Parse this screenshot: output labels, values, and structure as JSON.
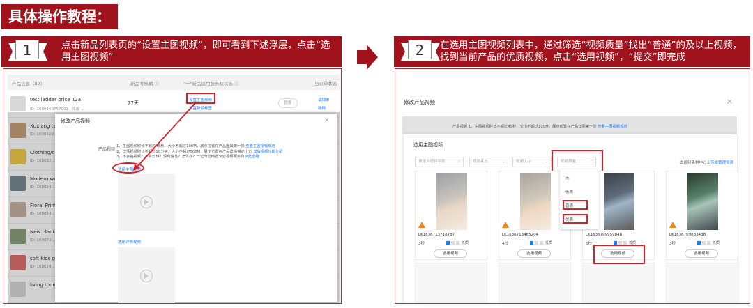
{
  "page_title": "具体操作教程：",
  "step1": {
    "num": "1",
    "text": "点击新品列表页的“设置主图视频”，即可看到下述浮层，点击“选用主图视频”"
  },
  "step2": {
    "num": "2",
    "text": "在选用主图视频列表中，通过筛选“视频质量”找出“普通”的及以上视频，找到当前产品的优质视频，点击“选用视频”，“提交”即完成"
  },
  "left_shot": {
    "header": {
      "col1": "产品信息（82）",
      "col2": "新品考核期 ⓘ",
      "col3": "\"一\"新品适用服务及状态 ⓘ",
      "col4": "当订单状态"
    },
    "rows": [
      {
        "name": "test ladder price 12a",
        "id": "ID: 1600169757001  | 降级 ⌄",
        "extra": "77天",
        "link1": "设置主图视频",
        "link2": "设置新品标签",
        "btn": "提报",
        "right1": "试销单",
        "right2": "新用"
      },
      {
        "name": "Xuxiang test",
        "id": "ID: 1600169..."
      },
      {
        "name": "Clothing/cur",
        "id": "ID: 160032..."
      },
      {
        "name": "Modern woo",
        "id": "ID: 160024..."
      },
      {
        "name": "Floral Print S",
        "id": "ID: 160024..."
      },
      {
        "name": "New planter",
        "id": "ID: 160024..."
      },
      {
        "name": "soft kids girl",
        "id": "ID: 160024..."
      },
      {
        "name": "living room s",
        "id": ""
      }
    ],
    "modal": {
      "title": "修改产品视频",
      "close": "×",
      "label": "产品视频",
      "info1": "1、主图视频时长不超过45秒，大小不超过100M，展示位置在产品图最第一张",
      "info1_link": "查看主图视频规范",
      "info2": "2、详情视频时长不超过10分钟，大小不超过500M，展示位置在产品详情描述上方",
      "info2_link": "详情视频功能介绍",
      "info3": "3、不会拍视频？不会剪辑？没有信息？怎么办？一记为您精选专业视频服务商",
      "info3_link": "点此查看",
      "select_main": "选用主图视频",
      "select_detail": "选用详情视频"
    }
  },
  "right_shot": {
    "title": "修改产品视频",
    "close": "×",
    "bar_label": "产品视频",
    "bar_text": "1、主图视频时长不超过45秒，大小不超过100M，展示位置在产品详图第一张",
    "bar_link": "查看主图视频规范",
    "inner_title": "选用主图视频",
    "search_placeholder": "请输入视频名称",
    "filter_status": "视频状态",
    "filter_size": "视频大小",
    "filter_quality": "视频质量",
    "right_link_prefix": "去视频素材中心上",
    "right_link": "传或管理视频",
    "dropdown_items": [
      "无",
      "低质",
      "普通",
      "优质"
    ],
    "cards": [
      {
        "code": "LK1636713718787",
        "dur": "3秒",
        "qual": "低质",
        "btn": "选用视频"
      },
      {
        "code": "LK1636713465204",
        "dur": "4秒",
        "qual": "低质",
        "btn": "选用视频"
      },
      {
        "code": "LK1636709959848",
        "dur": "6秒",
        "qual": "低质",
        "btn": "选用视频"
      },
      {
        "code": "LK1636709883438",
        "dur": "3秒",
        "qual": "低质",
        "btn": "选用视频"
      }
    ]
  },
  "colors": {
    "brand_red": "#a1131c",
    "highlight_red": "#e01e26",
    "link_blue": "#1677ff"
  }
}
